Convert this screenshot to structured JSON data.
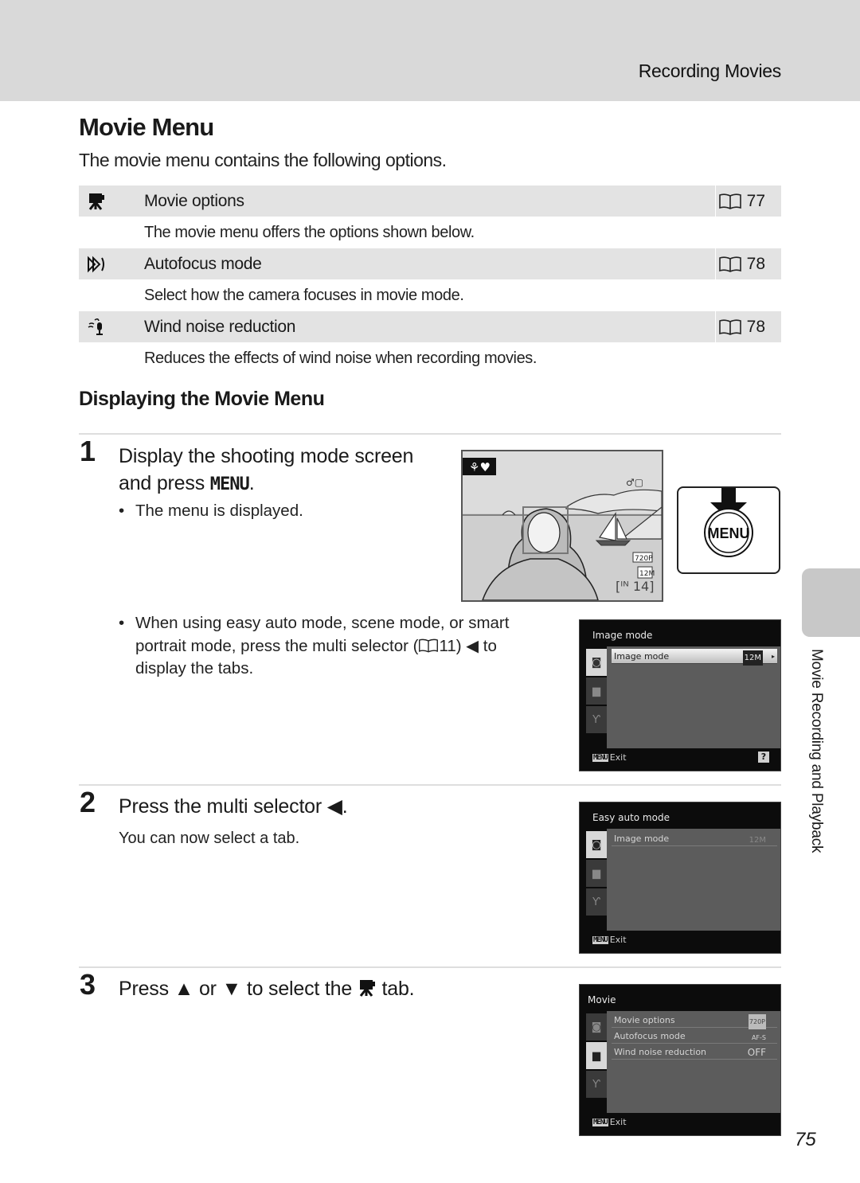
{
  "header": {
    "section_title": "Recording Movies"
  },
  "page": {
    "title": "Movie Menu",
    "intro": "The movie menu contains the following options.",
    "number": "75"
  },
  "options": [
    {
      "icon": "movie-camera-icon",
      "label": "Movie options",
      "ref_page": "77",
      "description": "The movie menu offers the options shown below."
    },
    {
      "icon": "autofocus-icon",
      "label": "Autofocus mode",
      "ref_page": "78",
      "description": "Select how the camera focuses in movie mode."
    },
    {
      "icon": "wind-noise-icon",
      "label": "Wind noise reduction",
      "ref_page": "78",
      "description": "Reduces the effects of wind noise when recording movies."
    }
  ],
  "sub_heading": "Displaying the Movie Menu",
  "steps": [
    {
      "number": "1",
      "line1": "Display the shooting mode screen",
      "line2_prefix": "and press ",
      "line2_key": "MENU",
      "line2_suffix": ".",
      "bullets": [
        "The menu is displayed.",
        "When using easy auto mode, scene mode, or smart portrait mode, press the multi selector (",
        "11) ",
        " to display the tabs."
      ]
    },
    {
      "number": "2",
      "text": "Press the multi selector ",
      "text_suffix": ".",
      "sub": "You can now select a tab."
    },
    {
      "number": "3",
      "text_a": "Press ",
      "text_b": " or ",
      "text_c": " to select the ",
      "text_d": " tab."
    }
  ],
  "bullet_line2_a": "portrait mode, press the multi selector (",
  "bullet_line2_b": "11) ",
  "bullet_line2_c": " to",
  "bullet_line3": "display the tabs.",
  "bullet_line1": "When using easy auto mode, scene mode, or smart",
  "lcd_preview": {
    "indicators": {
      "movie_res": "720P",
      "image_size": "12M",
      "remaining": "14",
      "memory": "IN"
    }
  },
  "menu_button_label": "MENU",
  "camera_screens": [
    {
      "title": "Image mode",
      "active_tab": "shooting",
      "items": [
        {
          "label": "Image mode",
          "value": "12M",
          "selected": true
        }
      ],
      "footer": "Exit",
      "menu_chip": "MENU",
      "help": "?"
    },
    {
      "title": "Easy auto mode",
      "active_tab": "shooting",
      "items": [
        {
          "label": "Image mode",
          "value": "12M",
          "selected": false
        }
      ],
      "footer": "Exit",
      "menu_chip": "MENU"
    },
    {
      "title": "Movie",
      "active_tab": "movie",
      "items": [
        {
          "label": "Movie options",
          "value": "720P",
          "selected": false
        },
        {
          "label": "Autofocus mode",
          "value": "AF-S",
          "selected": false
        },
        {
          "label": "Wind noise reduction",
          "value": "OFF",
          "selected": false
        }
      ],
      "footer": "Exit",
      "menu_chip": "MENU"
    }
  ],
  "side_tab": {
    "label": "Movie Recording and Playback"
  },
  "colors": {
    "header_band": "#d9d9d9",
    "row_band": "#e3e3e3",
    "side_tab": "#c8c8c8",
    "screen_pane": "#5c5c5c"
  }
}
